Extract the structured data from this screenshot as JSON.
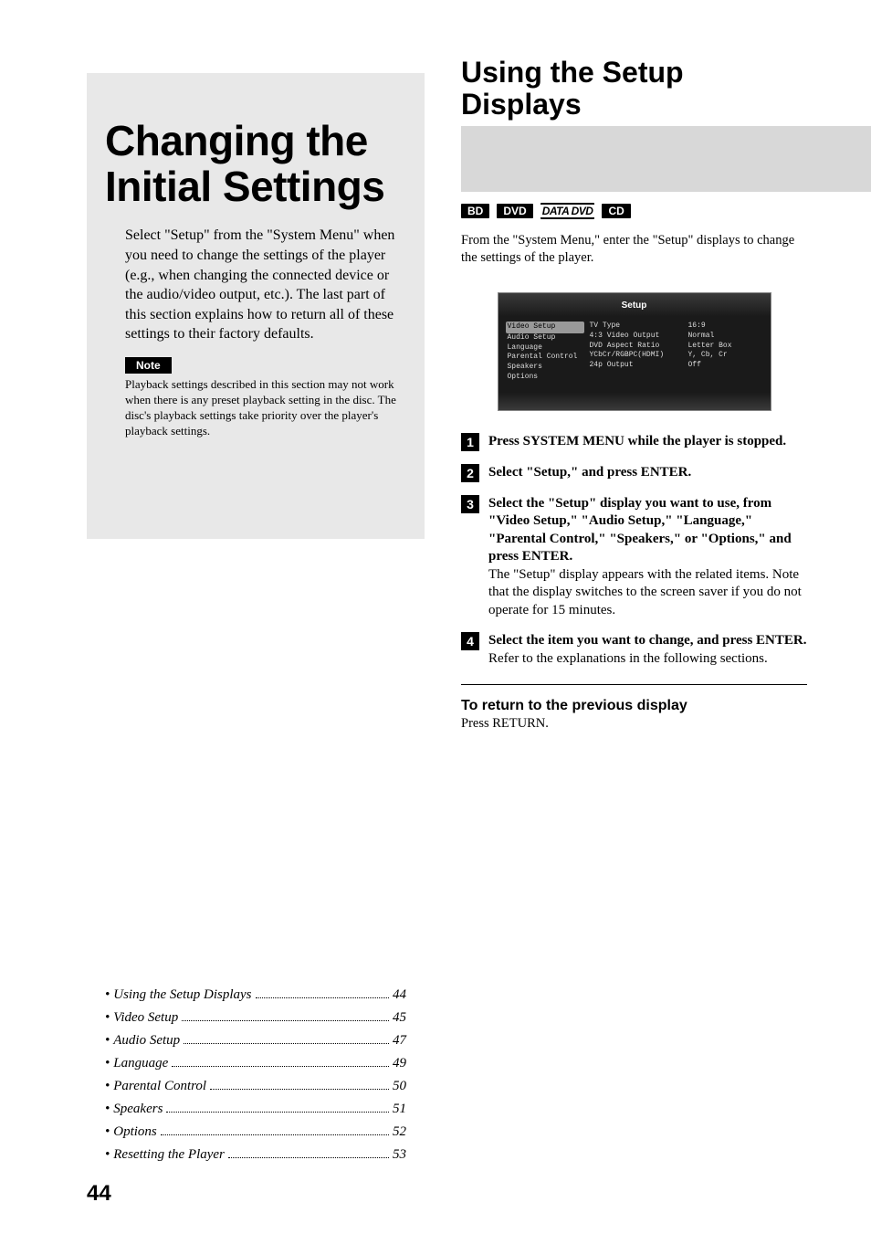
{
  "left": {
    "title": "Changing the Initial Settings",
    "intro": "Select \"Setup\" from the \"System Menu\" when you need to change the settings of the player (e.g., when changing the connected device or the audio/video output, etc.). The last part of this section explains how to return all of these settings to their factory defaults.",
    "note_label": "Note",
    "note_text": "Playback settings described in this section may not work when there is any preset playback setting in the disc. The disc's playback settings take priority over the player's playback settings."
  },
  "toc": [
    {
      "label": "Using the Setup Displays",
      "page": "44"
    },
    {
      "label": "Video Setup",
      "page": "45"
    },
    {
      "label": "Audio Setup",
      "page": "47"
    },
    {
      "label": "Language",
      "page": "49"
    },
    {
      "label": "Parental Control",
      "page": "50"
    },
    {
      "label": "Speakers",
      "page": "51"
    },
    {
      "label": "Options",
      "page": "52"
    },
    {
      "label": "Resetting the Player",
      "page": "53"
    }
  ],
  "page_number": "44",
  "right": {
    "title": "Using the Setup Displays",
    "badges": {
      "bd": "BD",
      "dvd": "DVD",
      "datadvd": "DATA DVD",
      "cd": "CD"
    },
    "intro": "From the \"System Menu,\" enter the \"Setup\" displays to change the settings of the player.",
    "screen": {
      "header": "Setup",
      "left_items": [
        "Video Setup",
        "Audio Setup",
        "Language",
        "Parental Control",
        "Speakers",
        "Options"
      ],
      "mid_items": [
        "TV Type",
        "4:3 Video Output",
        "DVD Aspect Ratio",
        "YCbCr/RGBPC(HDMI)",
        "24p Output"
      ],
      "right_items": [
        "16:9",
        "Normal",
        "Letter Box",
        "Y, Cb, Cr",
        "Off"
      ]
    },
    "steps": [
      {
        "num": "1",
        "bold": "Press SYSTEM MENU while the player is stopped.",
        "plain": ""
      },
      {
        "num": "2",
        "bold": "Select \"Setup,\" and press ENTER.",
        "plain": ""
      },
      {
        "num": "3",
        "bold": "Select the \"Setup\" display you want to use, from \"Video Setup,\" \"Audio Setup,\" \"Language,\" \"Parental Control,\" \"Speakers,\" or \"Options,\" and press ENTER.",
        "plain": "The \"Setup\" display appears with the related items. Note that the display switches to the screen saver if you do not operate for 15 minutes."
      },
      {
        "num": "4",
        "bold": "Select the item you want to change, and press ENTER.",
        "plain": "Refer to the explanations in the following sections."
      }
    ],
    "return_h": "To return to the previous display",
    "return_p": "Press RETURN."
  }
}
